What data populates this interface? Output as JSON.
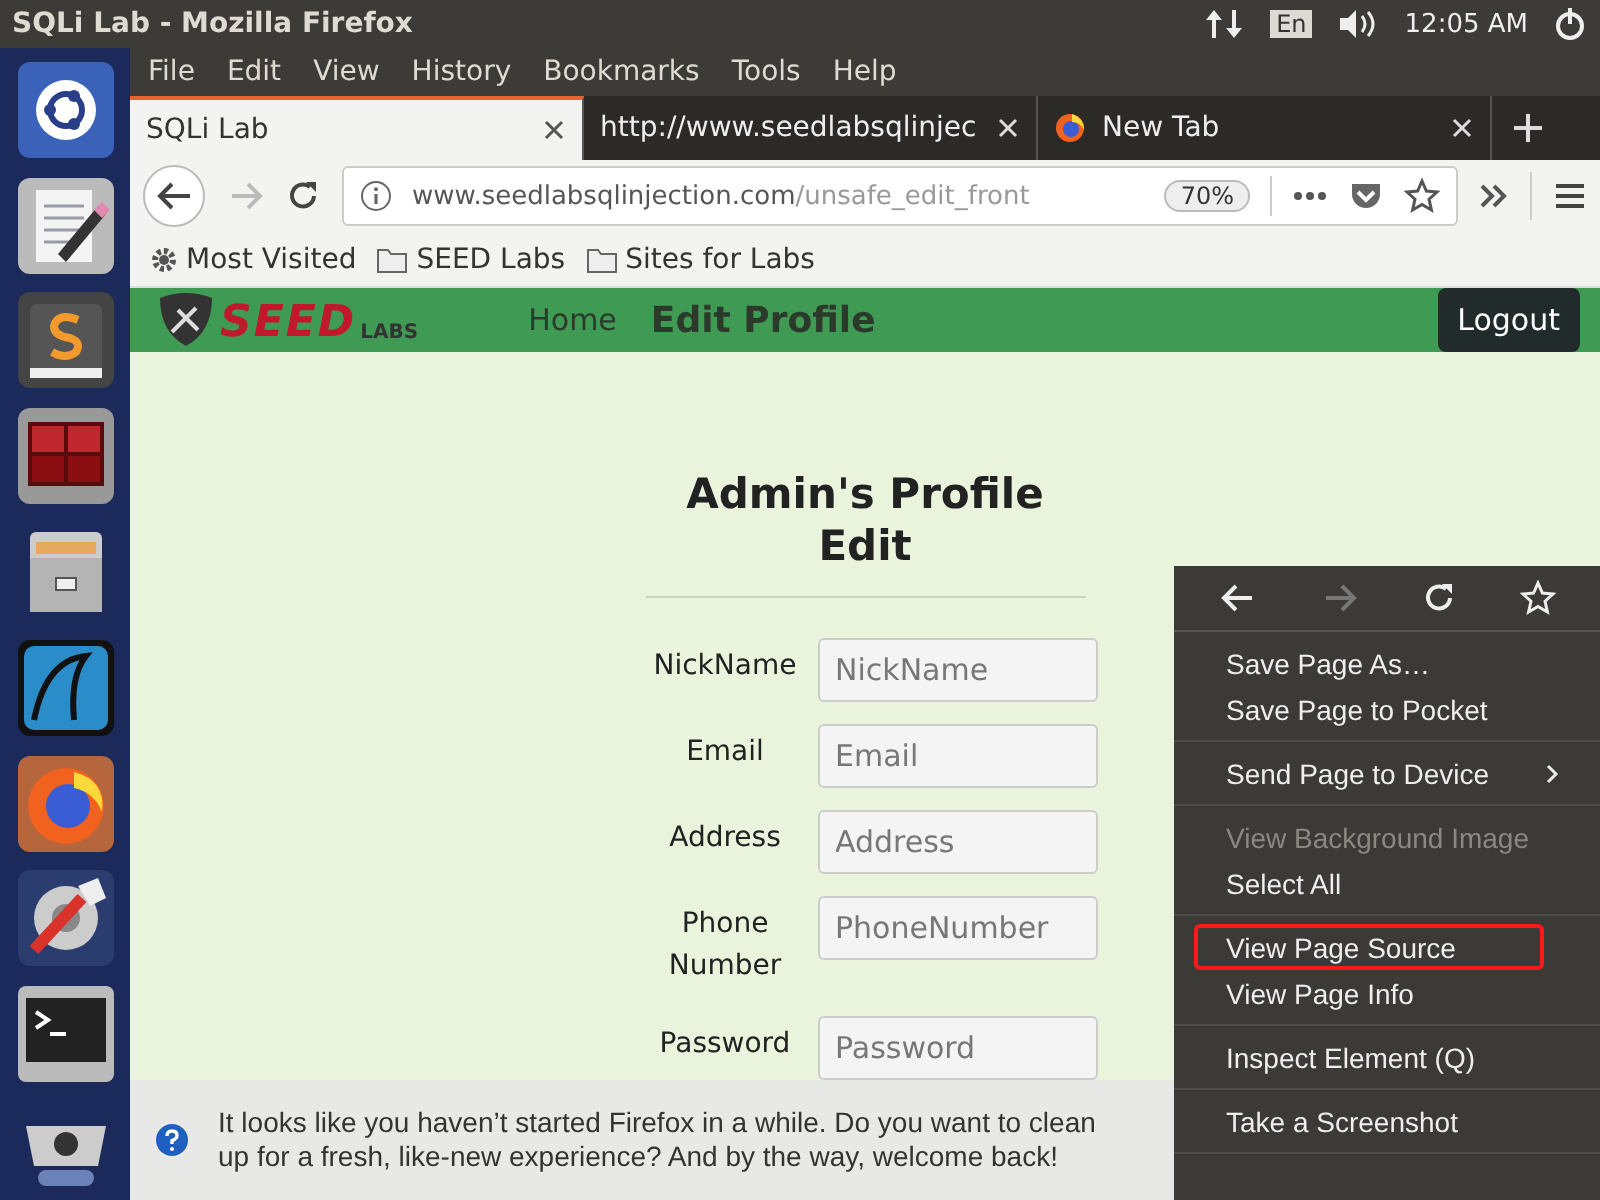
{
  "top_panel": {
    "title": "SQLi Lab - Mozilla Firefox",
    "keyboard_layout": "En",
    "clock": "12:05 AM"
  },
  "menu_bar": [
    "File",
    "Edit",
    "View",
    "History",
    "Bookmarks",
    "Tools",
    "Help"
  ],
  "tabs": [
    {
      "label": "SQLi Lab",
      "selected": true,
      "kind": "plain"
    },
    {
      "label": "http://www.seedlabsqlinjec",
      "selected": false,
      "kind": "plain"
    },
    {
      "label": "New Tab",
      "selected": false,
      "kind": "firefox"
    }
  ],
  "address_bar": {
    "forward_disabled": true,
    "url_host": "www.seedlabsqlinjection.com",
    "url_path": "/unsafe_edit_front",
    "zoom": "70%"
  },
  "bookmarks": [
    {
      "kind": "gear",
      "label": "Most Visited"
    },
    {
      "kind": "folder",
      "label": "SEED Labs"
    },
    {
      "kind": "folder",
      "label": "Sites for Labs"
    }
  ],
  "site_header": {
    "logo_main": "SEED",
    "logo_sub": "LABS",
    "nav": [
      {
        "label": "Home",
        "selected": false
      },
      {
        "label": "Edit Profile",
        "selected": true
      }
    ],
    "logout": "Logout"
  },
  "form": {
    "title": "Admin's Profile Edit",
    "fields": [
      {
        "label": "NickName",
        "placeholder": "NickName"
      },
      {
        "label": "Email",
        "placeholder": "Email"
      },
      {
        "label": "Address",
        "placeholder": "Address"
      },
      {
        "label": "Phone Number",
        "placeholder": "PhoneNumber"
      },
      {
        "label": "Password",
        "placeholder": "Password"
      }
    ]
  },
  "notification": {
    "text": "It looks like you haven’t started Firefox in a while. Do you want to clean up for a fresh, like-new experience? And by the way, welcome back!"
  },
  "context_menu": {
    "nav": [
      {
        "kind": "back",
        "disabled": false
      },
      {
        "kind": "forward",
        "disabled": true
      },
      {
        "kind": "reload",
        "disabled": false
      },
      {
        "kind": "bookmark",
        "disabled": false
      }
    ],
    "groups": [
      [
        {
          "label": "Save Page As…",
          "disabled": false,
          "marked": false,
          "submenu": false
        },
        {
          "label": "Save Page to Pocket",
          "disabled": false,
          "marked": false,
          "submenu": false
        }
      ],
      [
        {
          "label": "Send Page to Device",
          "disabled": false,
          "marked": false,
          "submenu": true
        }
      ],
      [
        {
          "label": "View Background Image",
          "disabled": true,
          "marked": false,
          "submenu": false
        },
        {
          "label": "Select All",
          "disabled": false,
          "marked": false,
          "submenu": false
        }
      ],
      [
        {
          "label": "View Page Source",
          "disabled": false,
          "marked": true,
          "submenu": false
        },
        {
          "label": "View Page Info",
          "disabled": false,
          "marked": false,
          "submenu": false
        }
      ],
      [
        {
          "label": "Inspect Element (Q)",
          "disabled": false,
          "marked": false,
          "submenu": false
        }
      ],
      [
        {
          "label": "Take a Screenshot",
          "disabled": false,
          "marked": false,
          "submenu": false
        }
      ]
    ]
  }
}
